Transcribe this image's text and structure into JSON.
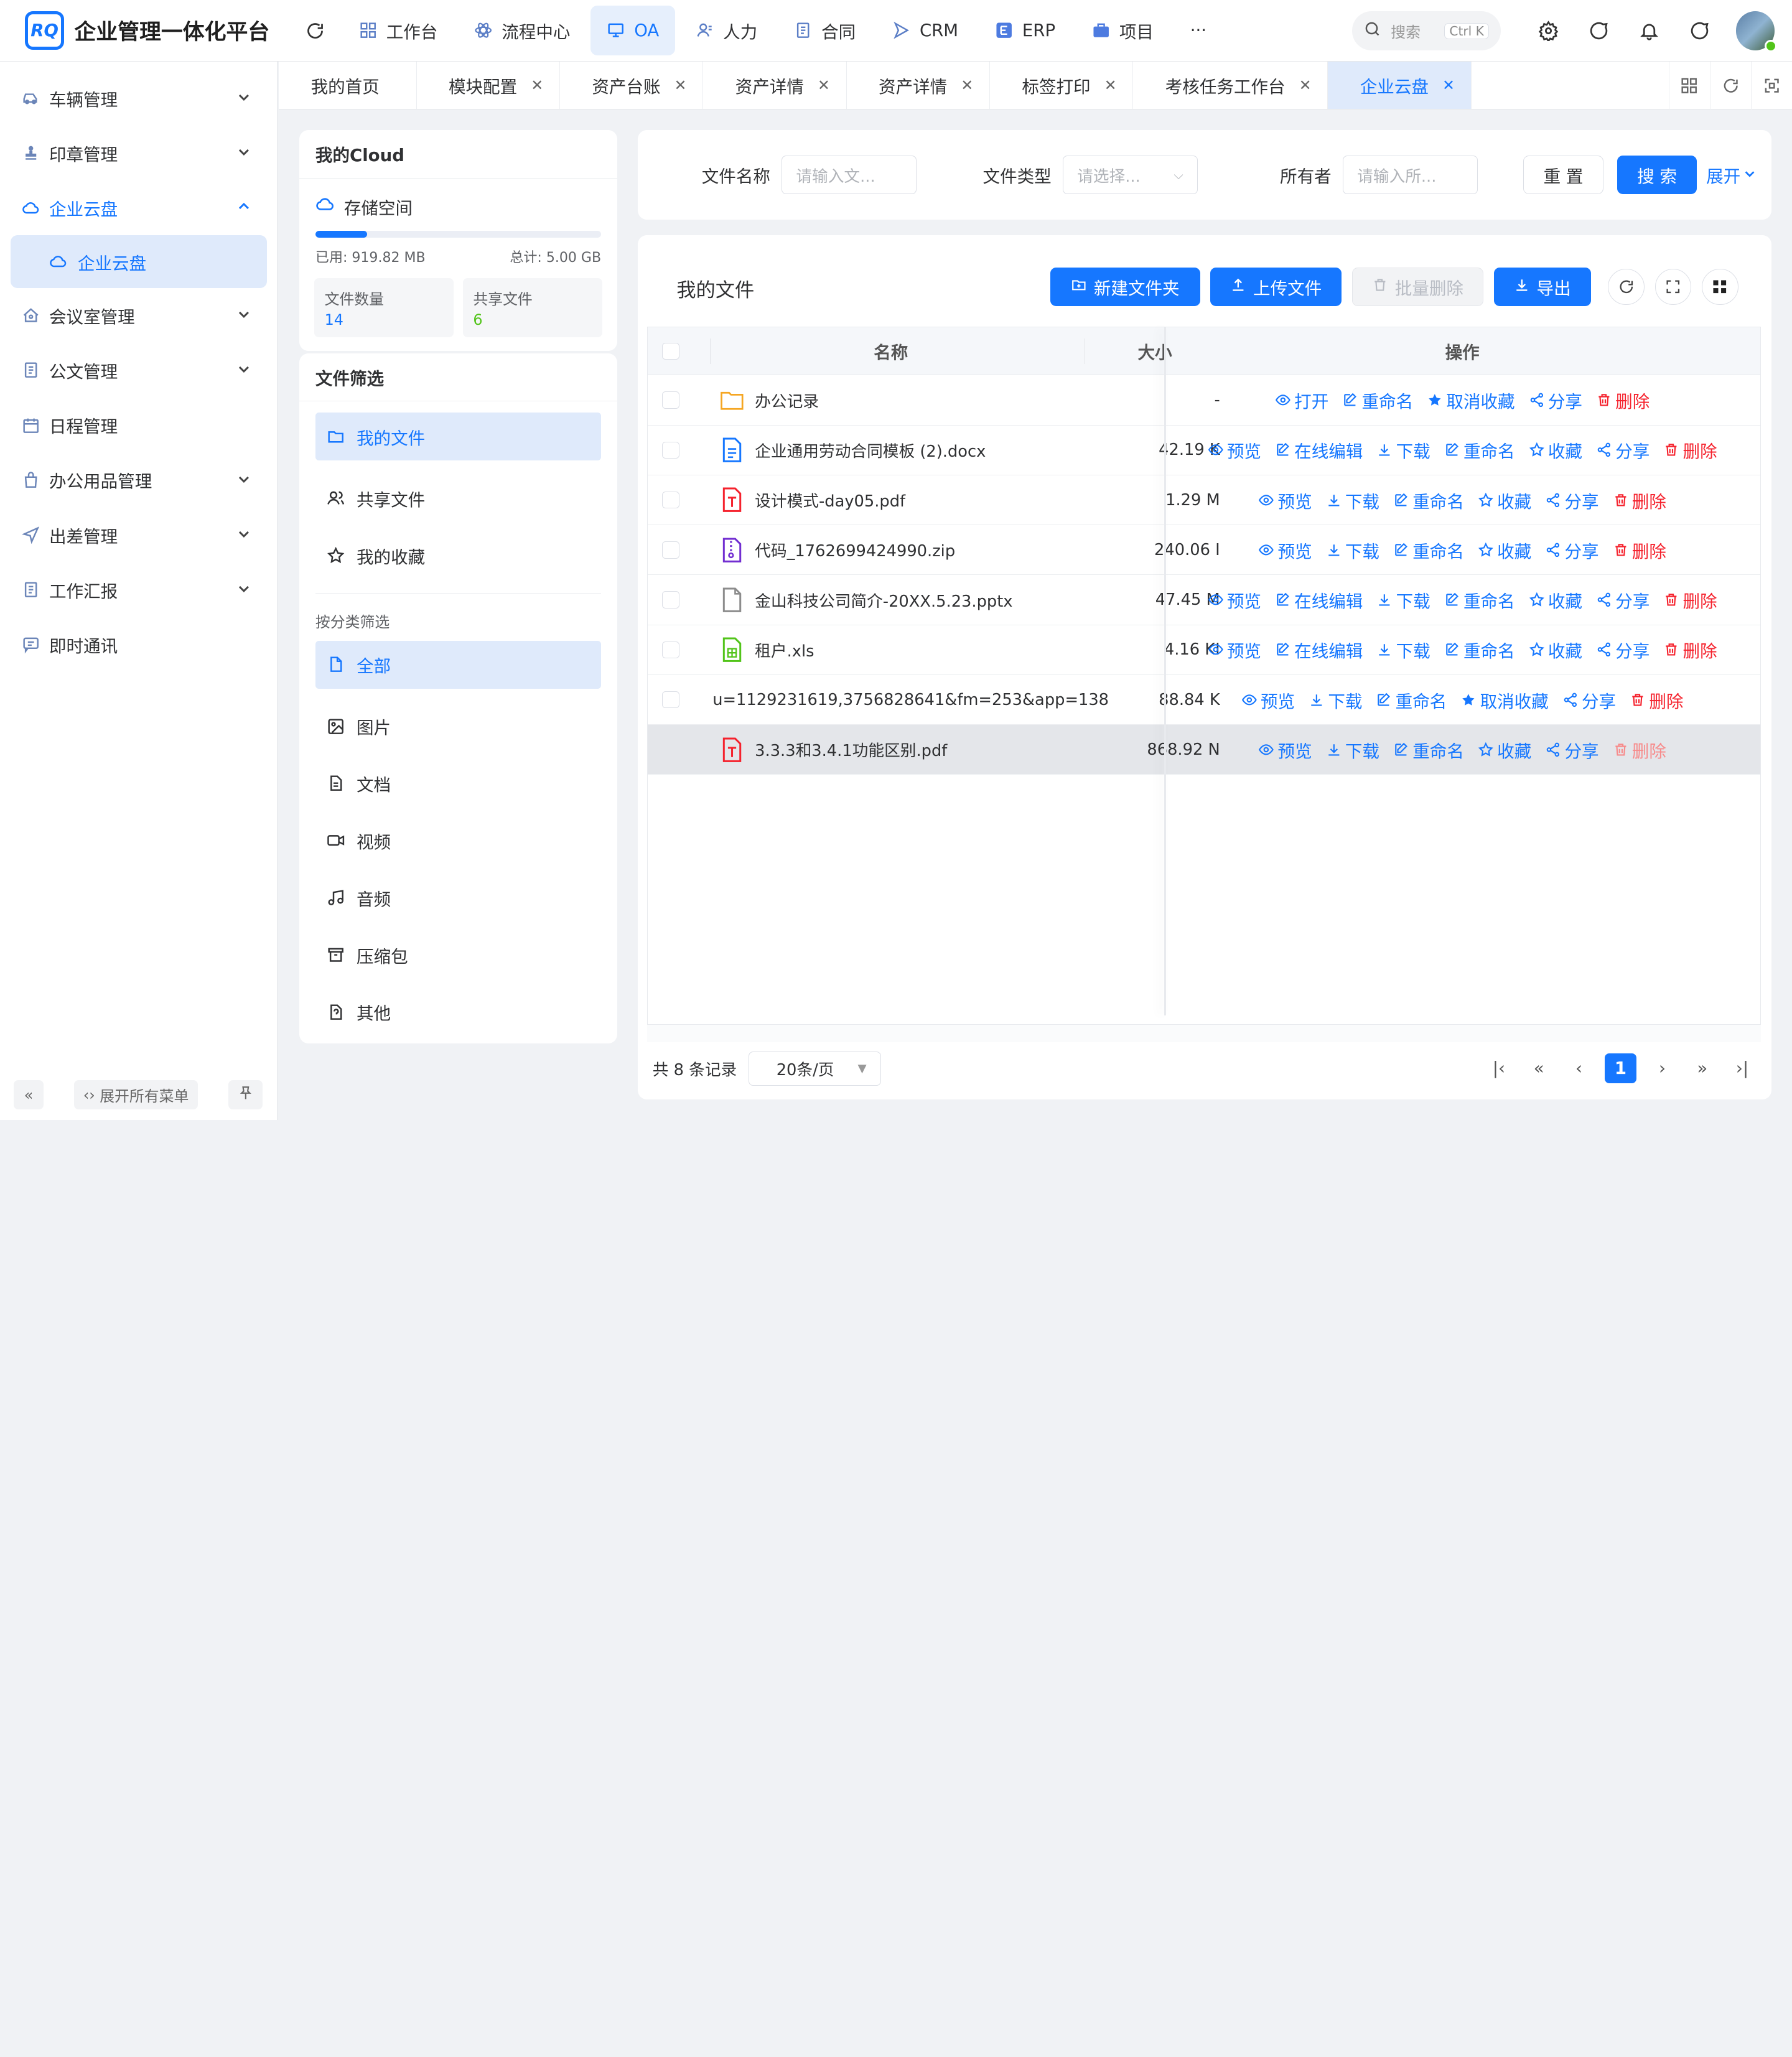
{
  "app": {
    "logo_mark": "RQ",
    "title": "企业管理一体化平台"
  },
  "topnav": [
    {
      "label": "工作台",
      "icon": "grid-icon"
    },
    {
      "label": "流程中心",
      "icon": "atom-icon"
    },
    {
      "label": "OA",
      "icon": "monitor-icon",
      "active": true
    },
    {
      "label": "人力",
      "icon": "user-icon"
    },
    {
      "label": "合同",
      "icon": "document-icon"
    },
    {
      "label": "CRM",
      "icon": "send-icon"
    },
    {
      "label": "ERP",
      "icon": "erp-icon"
    },
    {
      "label": "项目",
      "icon": "briefcase-icon"
    }
  ],
  "topnav_more": "···",
  "search": {
    "placeholder": "搜索",
    "shortcut": "Ctrl K"
  },
  "sidebar": {
    "items": [
      {
        "label": "车辆管理",
        "expand": true
      },
      {
        "label": "印章管理",
        "expand": true
      },
      {
        "label": "企业云盘",
        "expand": true,
        "open": true
      },
      {
        "label": "会议室管理",
        "expand": true
      },
      {
        "label": "公文管理",
        "expand": true
      },
      {
        "label": "日程管理",
        "expand": false
      },
      {
        "label": "办公用品管理",
        "expand": true
      },
      {
        "label": "出差管理",
        "expand": true
      },
      {
        "label": "工作汇报",
        "expand": true
      },
      {
        "label": "即时通讯",
        "expand": false
      }
    ],
    "sub_item": "企业云盘",
    "expand_all": "展开所有菜单"
  },
  "tabs": [
    {
      "label": "我的首页",
      "closable": false
    },
    {
      "label": "模块配置",
      "closable": true
    },
    {
      "label": "资产台账",
      "closable": true
    },
    {
      "label": "资产详情",
      "closable": true
    },
    {
      "label": "资产详情",
      "closable": true
    },
    {
      "label": "标签打印",
      "closable": true
    },
    {
      "label": "考核任务工作台",
      "closable": true
    },
    {
      "label": "企业云盘",
      "closable": true,
      "active": true
    }
  ],
  "cloud": {
    "title": "我的Cloud",
    "storage_label": "存储空间",
    "used": "已用: 919.82 MB",
    "total": "总计: 5.00 GB",
    "used_fraction": 0.18,
    "file_count_label": "文件数量",
    "file_count": "14",
    "shared_label": "共享文件",
    "shared_count": "6"
  },
  "filter": {
    "title": "文件筛选",
    "groups": [
      {
        "label": "我的文件",
        "icon": "folder-icon",
        "active": true
      },
      {
        "label": "共享文件",
        "icon": "users-icon"
      },
      {
        "label": "我的收藏",
        "icon": "star-icon"
      }
    ],
    "category_label": "按分类筛选",
    "categories": [
      {
        "label": "全部",
        "icon": "file-icon",
        "active": true
      },
      {
        "label": "图片",
        "icon": "image-icon"
      },
      {
        "label": "文档",
        "icon": "doc-icon"
      },
      {
        "label": "视频",
        "icon": "video-icon"
      },
      {
        "label": "音频",
        "icon": "music-icon"
      },
      {
        "label": "压缩包",
        "icon": "archive-icon"
      },
      {
        "label": "其他",
        "icon": "question-file-icon"
      }
    ]
  },
  "search_form": {
    "name_label": "文件名称",
    "name_placeholder": "请输入文...",
    "type_label": "文件类型",
    "type_placeholder": "请选择...",
    "owner_label": "所有者",
    "owner_placeholder": "请输入所...",
    "reset": "重 置",
    "search": "搜 索",
    "expand": "展开"
  },
  "files": {
    "title": "我的文件",
    "new_folder": "新建文件夹",
    "upload": "上传文件",
    "batch_delete": "批量删除",
    "export": "导出",
    "columns": {
      "name": "名称",
      "size": "大小",
      "ops": "操作"
    },
    "rows": [
      {
        "name": "办公记录",
        "type": "folder",
        "size": "-",
        "ops": [
          "打开",
          "重命名",
          "取消收藏",
          "分享",
          "删除"
        ]
      },
      {
        "name": "企业通用劳动合同模板 (2).docx",
        "type": "docx",
        "size": "42.19 K",
        "ops": [
          "预览",
          "在线编辑",
          "下载",
          "重命名",
          "收藏",
          "分享",
          "删除"
        ]
      },
      {
        "name": "设计模式-day05.pdf",
        "type": "pdf",
        "size": "1.29 M",
        "ops": [
          "预览",
          "下载",
          "重命名",
          "收藏",
          "分享",
          "删除"
        ]
      },
      {
        "name": "代码_1762699424990.zip",
        "type": "zip",
        "size": "240.06 I",
        "ops": [
          "预览",
          "下载",
          "重命名",
          "收藏",
          "分享",
          "删除"
        ]
      },
      {
        "name": "金山科技公司简介-20XX.5.23.pptx",
        "type": "pptx",
        "size": "47.45 M",
        "ops": [
          "预览",
          "在线编辑",
          "下载",
          "重命名",
          "收藏",
          "分享",
          "删除"
        ]
      },
      {
        "name": "租户.xls",
        "type": "xls",
        "size": "4.16 KI",
        "ops": [
          "预览",
          "在线编辑",
          "下载",
          "重命名",
          "收藏",
          "分享",
          "删除"
        ]
      },
      {
        "name": "u=1129231619,3756828641&fm=253&app=138",
        "type": "image",
        "size": "88.84 K",
        "ops": [
          "预览",
          "下载",
          "重命名",
          "取消收藏",
          "分享",
          "删除"
        ]
      },
      {
        "name": "3.3.3和3.4.1功能区别.pdf",
        "type": "pdf",
        "size": "868.92 N",
        "ops": [
          "预览",
          "下载",
          "重命名",
          "收藏",
          "分享",
          "删除"
        ],
        "highlight": true
      }
    ]
  },
  "pager": {
    "total": "共 8 条记录",
    "page_size": "20条/页",
    "current": "1"
  },
  "colors": {
    "primary": "#1677ff",
    "danger": "#f5222d",
    "active_bg": "#dfeafb"
  }
}
